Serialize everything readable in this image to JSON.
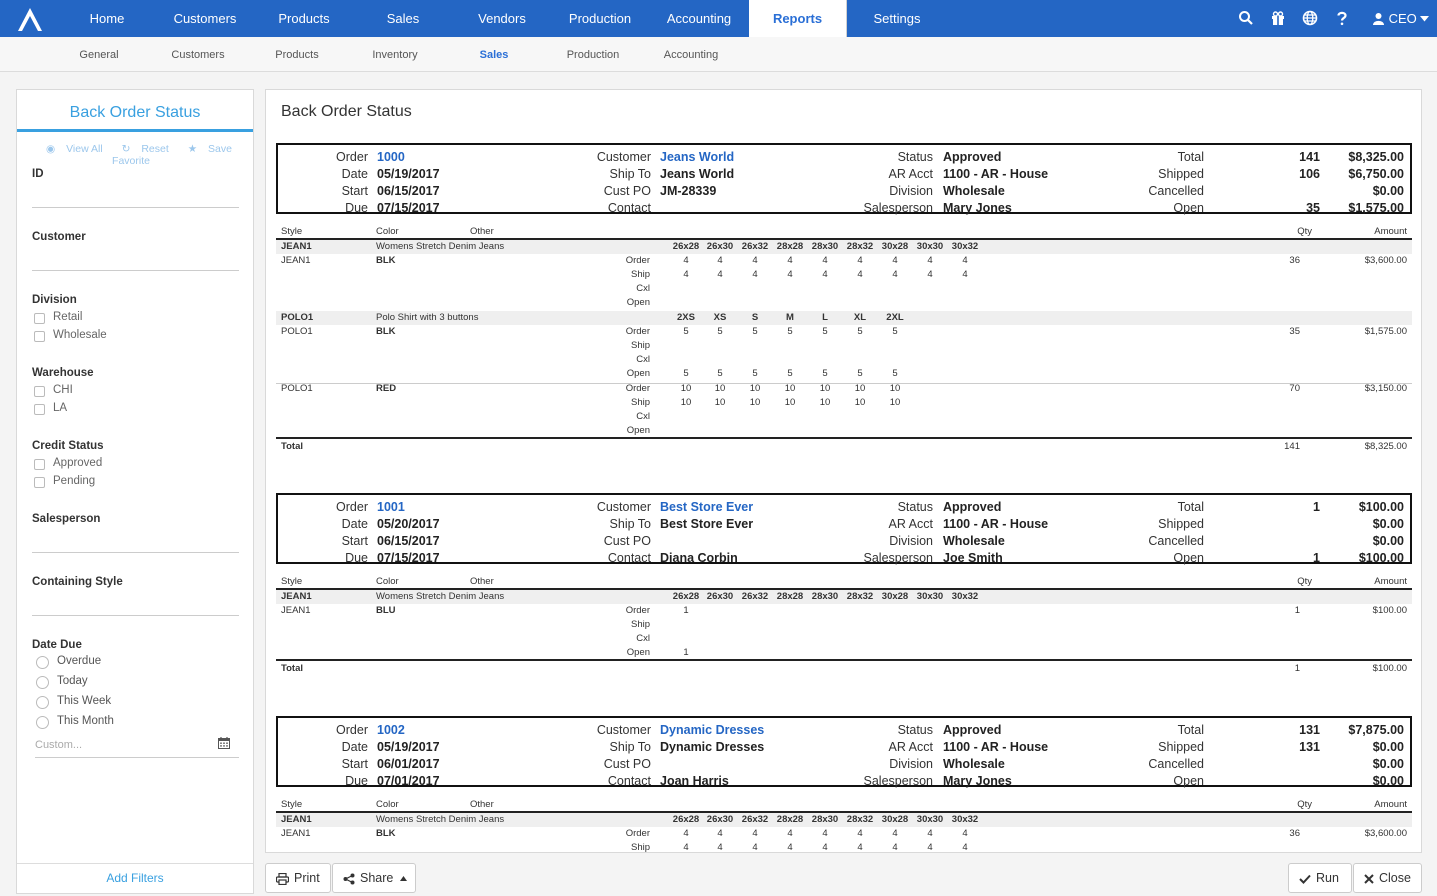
{
  "nav": {
    "items": [
      "Home",
      "Customers",
      "Products",
      "Sales",
      "Vendors",
      "Production",
      "Accounting",
      "Reports",
      "Settings"
    ],
    "active": "Reports",
    "user": "CEO",
    "icons": [
      "search-icon",
      "gift-icon",
      "globe-icon",
      "help-icon",
      "user-icon"
    ]
  },
  "subnav": {
    "items": [
      "General",
      "Customers",
      "Products",
      "Inventory",
      "Sales",
      "Production",
      "Accounting"
    ],
    "active": "Sales"
  },
  "sidebar": {
    "title": "Back Order Status",
    "actions": [
      "View All",
      "Reset",
      "Save Favorite"
    ],
    "filters": {
      "id": "ID",
      "customer": "Customer",
      "division": "Division",
      "division_opts": [
        "Retail",
        "Wholesale"
      ],
      "warehouse": "Warehouse",
      "warehouse_opts": [
        "CHI",
        "LA"
      ],
      "credit": "Credit Status",
      "credit_opts": [
        "Approved",
        "Pending"
      ],
      "salesperson": "Salesperson",
      "style": "Containing Style",
      "date_due": "Date Due",
      "date_opts": [
        "Overdue",
        "Today",
        "This Week",
        "This Month"
      ],
      "custom_placeholder": "Custom..."
    },
    "add_filters": "Add Filters"
  },
  "report": {
    "title": "Back Order Status",
    "labels": {
      "order": "Order",
      "date": "Date",
      "start": "Start",
      "due": "Due",
      "customer": "Customer",
      "ship_to": "Ship To",
      "cust_po": "Cust PO",
      "contact": "Contact",
      "status": "Status",
      "ar_acct": "AR Acct",
      "division": "Division",
      "salesperson": "Salesperson",
      "total": "Total",
      "shipped": "Shipped",
      "cancelled": "Cancelled",
      "open": "Open",
      "style": "Style",
      "color": "Color",
      "other": "Other",
      "qty": "Qty",
      "amount": "Amount",
      "r_order": "Order",
      "r_ship": "Ship",
      "r_cxl": "Cxl",
      "r_open": "Open",
      "grand_total": "Total"
    },
    "orders": [
      {
        "order": "1000",
        "date": "05/19/2017",
        "start": "06/15/2017",
        "due": "07/15/2017",
        "customer": "Jeans World",
        "ship_to": "Jeans World",
        "cust_po": "JM-28339",
        "contact": "",
        "status": "Approved",
        "ar_acct": "1100 - AR - House",
        "division": "Wholesale",
        "salesperson": "Mary Jones",
        "total_qty": "141",
        "total_amt": "$8,325.00",
        "shipped_qty": "106",
        "shipped_amt": "$6,750.00",
        "cancelled_qty": "",
        "cancelled_amt": "$0.00",
        "open_qty": "35",
        "open_amt": "$1,575.00",
        "grand_qty": "141",
        "grand_amt": "$8,325.00"
      },
      {
        "order": "1001",
        "date": "05/20/2017",
        "start": "06/15/2017",
        "due": "07/15/2017",
        "customer": "Best Store Ever",
        "ship_to": "Best Store Ever",
        "cust_po": "",
        "contact": "Diana Corbin",
        "status": "Approved",
        "ar_acct": "1100 - AR - House",
        "division": "Wholesale",
        "salesperson": "Joe Smith",
        "total_qty": "1",
        "total_amt": "$100.00",
        "shipped_qty": "",
        "shipped_amt": "$0.00",
        "cancelled_qty": "",
        "cancelled_amt": "$0.00",
        "open_qty": "1",
        "open_amt": "$100.00",
        "grand_qty": "1",
        "grand_amt": "$100.00"
      },
      {
        "order": "1002",
        "date": "05/19/2017",
        "start": "06/01/2017",
        "due": "07/01/2017",
        "customer": "Dynamic Dresses",
        "ship_to": "Dynamic Dresses",
        "cust_po": "",
        "contact": "Joan Harris",
        "status": "Approved",
        "ar_acct": "1100 - AR - House",
        "division": "Wholesale",
        "salesperson": "Mary Jones",
        "total_qty": "131",
        "total_amt": "$7,875.00",
        "shipped_qty": "131",
        "shipped_amt": "$0.00",
        "cancelled_qty": "",
        "cancelled_amt": "$0.00",
        "open_qty": "",
        "open_amt": "$0.00"
      }
    ],
    "jean_sizes": [
      "26x28",
      "26x30",
      "26x32",
      "28x28",
      "28x30",
      "28x32",
      "30x28",
      "30x30",
      "30x32"
    ],
    "polo_sizes": [
      "2XS",
      "XS",
      "S",
      "M",
      "L",
      "XL",
      "2XL"
    ],
    "groups": {
      "jean1": {
        "style": "JEAN1",
        "desc": "Womens Stretch Denim Jeans"
      },
      "polo1": {
        "style": "POLO1",
        "desc": "Polo Shirt with 3 buttons"
      }
    },
    "lines": [
      {
        "style": "JEAN1",
        "color": "BLK",
        "qty": "36",
        "amount": "$3,600.00",
        "order": [
          "4",
          "4",
          "4",
          "4",
          "4",
          "4",
          "4",
          "4",
          "4"
        ],
        "ship": [
          "4",
          "4",
          "4",
          "4",
          "4",
          "4",
          "4",
          "4",
          "4"
        ],
        "cxl": [],
        "open": []
      },
      {
        "style": "POLO1",
        "color": "BLK",
        "qty": "35",
        "amount": "$1,575.00",
        "order": [
          "5",
          "5",
          "5",
          "5",
          "5",
          "5",
          "5"
        ],
        "ship": [],
        "cxl": [],
        "open": [
          "5",
          "5",
          "5",
          "5",
          "5",
          "5",
          "5"
        ]
      },
      {
        "style": "POLO1",
        "color": "RED",
        "qty": "70",
        "amount": "$3,150.00",
        "order": [
          "10",
          "10",
          "10",
          "10",
          "10",
          "10",
          "10"
        ],
        "ship": [
          "10",
          "10",
          "10",
          "10",
          "10",
          "10",
          "10"
        ],
        "cxl": [],
        "open": []
      },
      {
        "style": "JEAN1",
        "color": "BLU",
        "qty": "1",
        "amount": "$100.00",
        "order": [
          "1"
        ],
        "ship": [],
        "cxl": [],
        "open": [
          "1"
        ]
      },
      {
        "style": "JEAN1",
        "color": "BLK",
        "qty": "36",
        "amount": "$3,600.00",
        "order": [
          "4",
          "4",
          "4",
          "4",
          "4",
          "4",
          "4",
          "4",
          "4"
        ],
        "ship": [
          "4",
          "4",
          "4",
          "4",
          "4",
          "4",
          "4",
          "4",
          "4"
        ],
        "cxl": [],
        "open": []
      }
    ]
  },
  "buttons": {
    "print": "Print",
    "share": "Share",
    "run": "Run",
    "close": "Close"
  }
}
